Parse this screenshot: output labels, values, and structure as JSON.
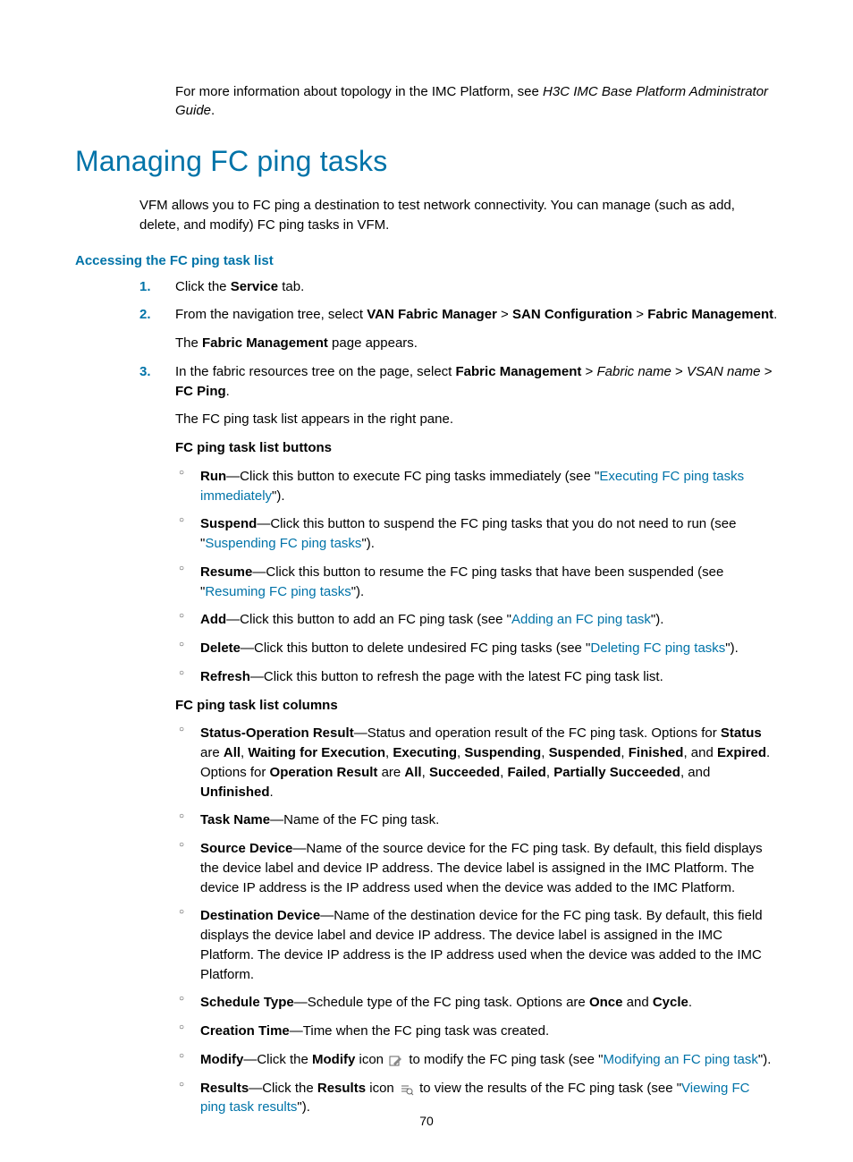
{
  "intro_top_a": "For more information about topology in the IMC Platform, see ",
  "intro_top_b": "H3C IMC Base Platform Administrator Guide",
  "intro_top_c": ".",
  "heading": "Managing FC ping tasks",
  "intro": "VFM allows you to FC ping a destination to test network connectivity. You can manage (such as add, delete, and modify) FC ping tasks in VFM.",
  "subheading": "Accessing the FC ping task list",
  "steps": {
    "s1": {
      "num": "1.",
      "a": "Click the ",
      "b": "Service",
      "c": " tab."
    },
    "s2": {
      "num": "2.",
      "a": "From the navigation tree, select ",
      "b": "VAN Fabric Manager",
      "gt1": " > ",
      "c": "SAN Configuration",
      "gt2": " > ",
      "d": "Fabric Management",
      "e": ".",
      "p2a": "The ",
      "p2b": "Fabric Management",
      "p2c": " page appears."
    },
    "s3": {
      "num": "3.",
      "a": "In the fabric resources tree on the page, select ",
      "b": "Fabric Management",
      "gt1": " > ",
      "c": "Fabric name",
      "gt2": " > ",
      "d": "VSAN name",
      "gt3": " > ",
      "e": "FC Ping",
      "f": ".",
      "p2": "The FC ping task list appears in the right pane.",
      "buttons_heading": "FC ping task list buttons",
      "columns_heading": "FC ping task list columns"
    }
  },
  "buttons": {
    "run": {
      "t": "Run",
      "desc": "—Click this button to execute FC ping tasks immediately (see \"",
      "link": "Executing FC ping tasks immediately",
      "after": "\")."
    },
    "suspend": {
      "t": "Suspend",
      "desc": "—Click this button to suspend the FC ping tasks that you do not need to run (see \"",
      "link": "Suspending FC ping tasks",
      "after": "\")."
    },
    "resume": {
      "t": "Resume",
      "desc": "—Click this button to resume the FC ping tasks that have been suspended (see \"",
      "link": "Resuming FC ping tasks",
      "after": "\")."
    },
    "add": {
      "t": "Add",
      "desc": "—Click this button to add an FC ping task (see \"",
      "link": "Adding an FC ping task",
      "after": "\")."
    },
    "del": {
      "t": "Delete",
      "desc": "—Click this button to delete undesired FC ping tasks (see \"",
      "link": "Deleting FC ping tasks",
      "after": "\")."
    },
    "refresh": {
      "t": "Refresh",
      "desc": "—Click this button to refresh the page with the latest FC ping task list."
    }
  },
  "columns": {
    "status": {
      "t": "Status-Operation Result",
      "d1": "—Status and operation result of the FC ping task. Options for ",
      "b1": "Status",
      "d2": " are ",
      "o1": "All",
      "c": ", ",
      "o2": "Waiting for Execution",
      "o3": "Executing",
      "o4": "Suspending",
      "o5": "Suspended",
      "o6": "Finished",
      "and": ", and ",
      "o7": "Expired",
      "d3": ". Options for ",
      "b2": "Operation Result",
      "d4": " are ",
      "p1": "All",
      "p2": "Succeeded",
      "p3": "Failed",
      "p4": "Partially Succeeded",
      "p5": "Unfinished",
      "end": "."
    },
    "taskname": {
      "t": "Task Name",
      "d": "—Name of the FC ping task."
    },
    "srcdev": {
      "t": "Source Device",
      "d": "—Name of the source device for the FC ping task. By default, this field displays the device label and device IP address. The device label is assigned in the IMC Platform. The device IP address is the IP address used when the device was added to the IMC Platform."
    },
    "dstdev": {
      "t": "Destination Device",
      "d": "—Name of the destination device for the FC ping task. By default, this field displays the device label and device IP address. The device label is assigned in the IMC Platform. The device IP address is the IP address used when the device was added to the IMC Platform."
    },
    "sched": {
      "t": "Schedule Type",
      "d1": "—Schedule type of the FC ping task. Options are ",
      "o1": "Once",
      "and": " and ",
      "o2": "Cycle",
      "end": "."
    },
    "ctime": {
      "t": "Creation Time",
      "d": "—Time when the FC ping task was created."
    },
    "modify": {
      "t": "Modify",
      "d1": "—Click the ",
      "b": "Modify",
      "d2": " icon ",
      "d3": " to modify the FC ping task (see \"",
      "link": "Modifying an FC ping task",
      "after": "\")."
    },
    "results": {
      "t": "Results",
      "d1": "—Click the ",
      "b": "Results",
      "d2": " icon ",
      "d3": " to view the results of the FC ping task (see \"",
      "link": "Viewing FC ping task results",
      "after": "\")."
    }
  },
  "pagenum": "70"
}
